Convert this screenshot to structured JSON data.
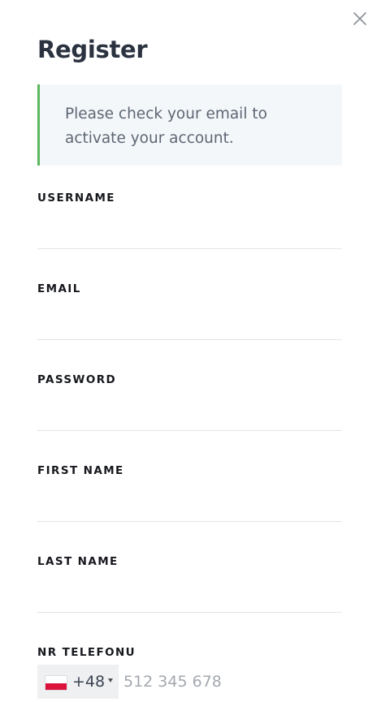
{
  "header": {
    "title": "Register",
    "close_icon": "close-icon"
  },
  "notice": {
    "text": "Please check your email to activate your account.",
    "accent_color": "#5cb85c"
  },
  "form": {
    "username": {
      "label": "USERNAME",
      "value": ""
    },
    "email": {
      "label": "EMAIL",
      "value": ""
    },
    "password": {
      "label": "PASSWORD",
      "value": ""
    },
    "first_name": {
      "label": "FIRST NAME",
      "value": ""
    },
    "last_name": {
      "label": "LAST NAME",
      "value": ""
    },
    "phone": {
      "label": "NR TELEFONU",
      "country_flag": "poland-flag-icon",
      "dial_code": "+48",
      "placeholder": "512 345 678",
      "value": ""
    }
  }
}
